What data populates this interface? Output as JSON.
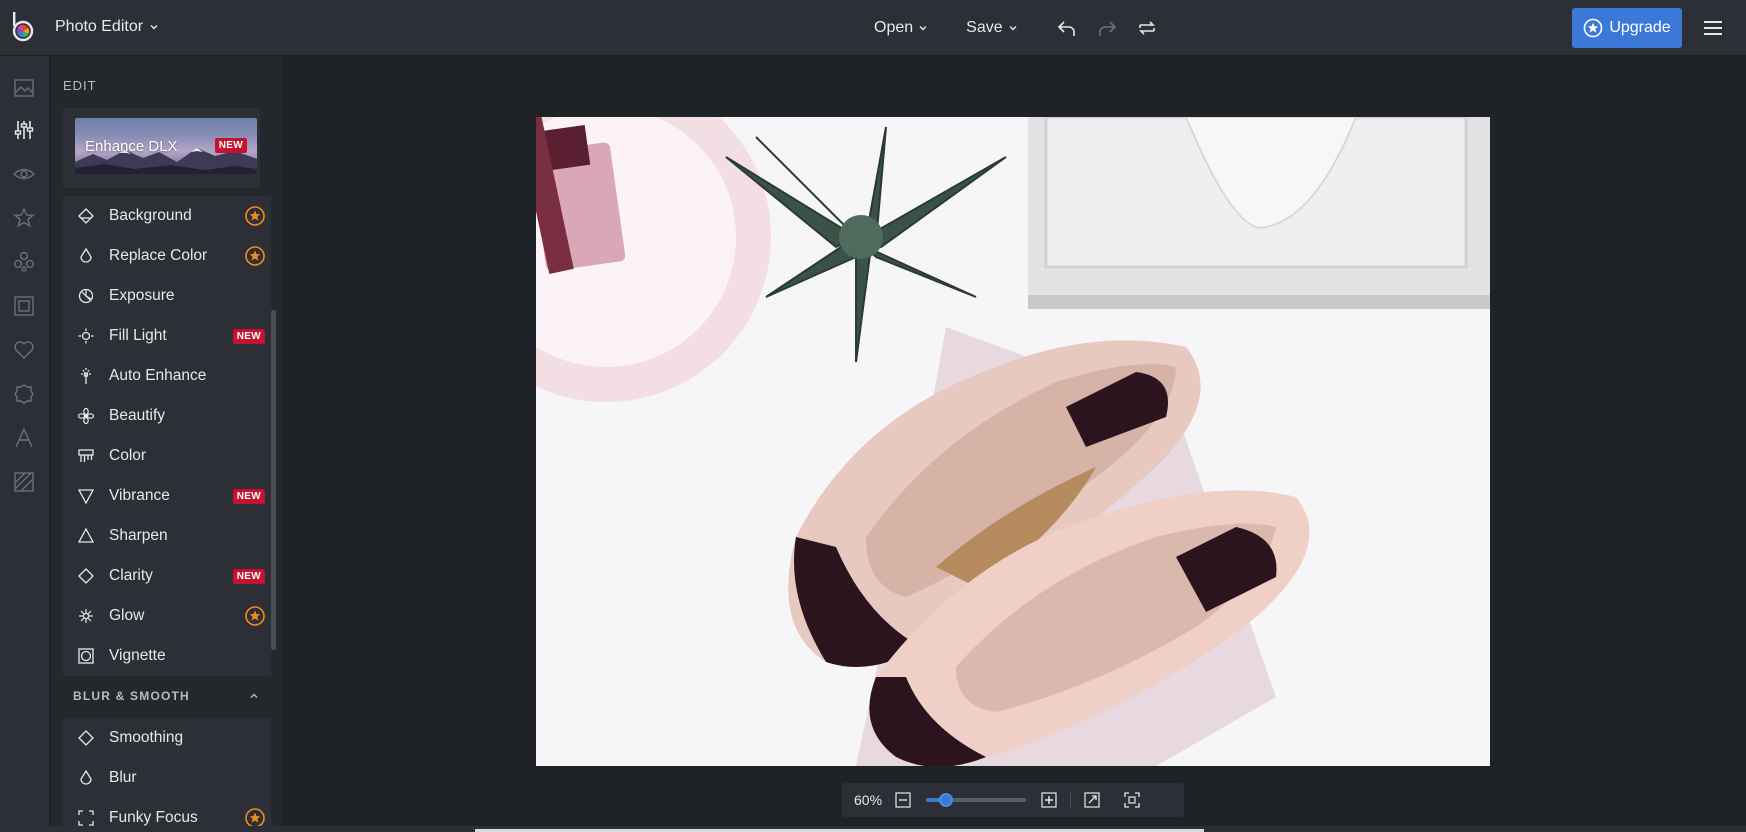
{
  "app": {
    "title": "Photo Editor"
  },
  "toolbar": {
    "open_label": "Open",
    "save_label": "Save"
  },
  "upgrade_label": "Upgrade",
  "panel": {
    "heading": "EDIT",
    "enhance": {
      "label": "Enhance DLX",
      "badge": "NEW"
    },
    "tools": [
      {
        "label": "Background",
        "icon": "background-icon",
        "badge": "star"
      },
      {
        "label": "Replace Color",
        "icon": "drop-icon",
        "badge": "star"
      },
      {
        "label": "Exposure",
        "icon": "exposure-icon",
        "badge": ""
      },
      {
        "label": "Fill Light",
        "icon": "light-icon",
        "badge": "NEW"
      },
      {
        "label": "Auto Enhance",
        "icon": "wand-icon",
        "badge": ""
      },
      {
        "label": "Beautify",
        "icon": "flower-icon",
        "badge": ""
      },
      {
        "label": "Color",
        "icon": "palette-icon",
        "badge": ""
      },
      {
        "label": "Vibrance",
        "icon": "triangle-down-icon",
        "badge": "NEW"
      },
      {
        "label": "Sharpen",
        "icon": "triangle-icon",
        "badge": ""
      },
      {
        "label": "Clarity",
        "icon": "diamond-icon",
        "badge": "NEW"
      },
      {
        "label": "Glow",
        "icon": "sparkle-icon",
        "badge": "star"
      },
      {
        "label": "Vignette",
        "icon": "vignette-icon",
        "badge": ""
      }
    ],
    "section2": {
      "label": "BLUR & SMOOTH",
      "tools": [
        {
          "label": "Smoothing",
          "icon": "diamond-icon",
          "badge": ""
        },
        {
          "label": "Blur",
          "icon": "drop-icon",
          "badge": ""
        },
        {
          "label": "Funky Focus",
          "icon": "focus-icon",
          "badge": "star"
        }
      ]
    }
  },
  "zoom": {
    "value": "60%",
    "level": 0.2
  },
  "colors": {
    "accent": "#3c78d8",
    "new_badge": "#c4122f",
    "star": "#f08c1e"
  }
}
